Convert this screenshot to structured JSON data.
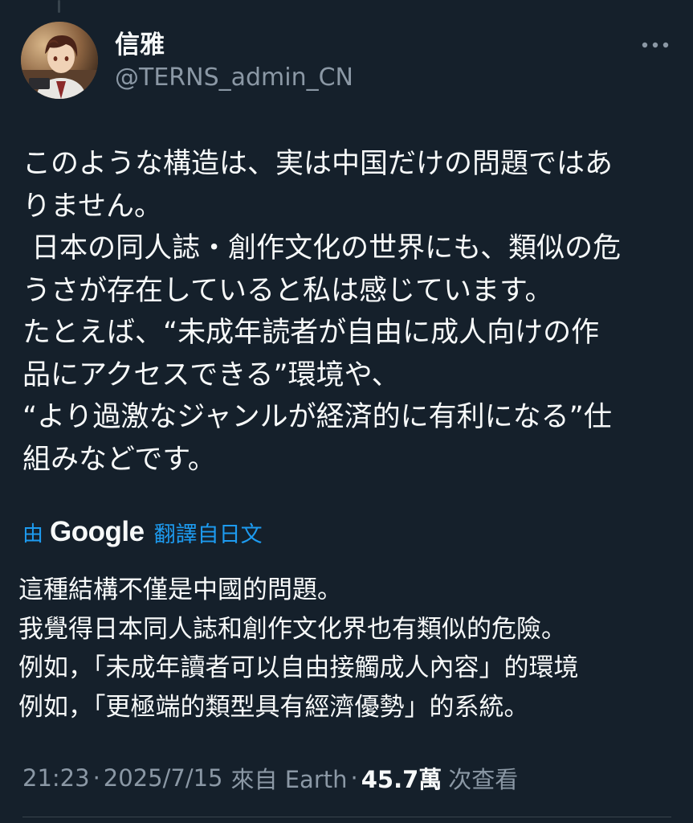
{
  "author": {
    "display_name": "信雅",
    "handle": "@TERNS_admin_CN",
    "avatar_icon": "anime-character-avatar"
  },
  "more_icon": "more-horizontal-icon",
  "tweet": {
    "lines": [
      "このような構造は、実は中国だけの問題ではあ",
      "りません。",
      " 日本の同人誌・創作文化の世界にも、類似の危",
      "うさが存在していると私は感じています。",
      "たとえば、“未成年読者が自由に成人向けの作",
      "品にアクセスできる”環境や、",
      "“より過激なジャンルが経済的に有利になる”仕",
      "組みなどです。"
    ]
  },
  "translation": {
    "by_label": "由",
    "provider": "Google",
    "translated_from": "翻譯自日文",
    "lines": [
      "這種結構不僅是中國的問題。",
      "我覺得日本同人誌和創作文化界也有類似的危險。",
      "例如，「未成年讀者可以自由接觸成人內容」的環境",
      "例如，「更極端的類型具有經濟優勢」的系統。"
    ]
  },
  "meta": {
    "time": "21:23",
    "separator": "·",
    "date": "2025/7/15",
    "source": "來自 Earth",
    "views_count": "45.7萬",
    "views_label": "次查看"
  },
  "colors": {
    "background": "#15202b",
    "text": "#f7f9f9",
    "secondary_text": "#8b98a5",
    "link": "#1d9bf0",
    "divider": "#38444d"
  }
}
